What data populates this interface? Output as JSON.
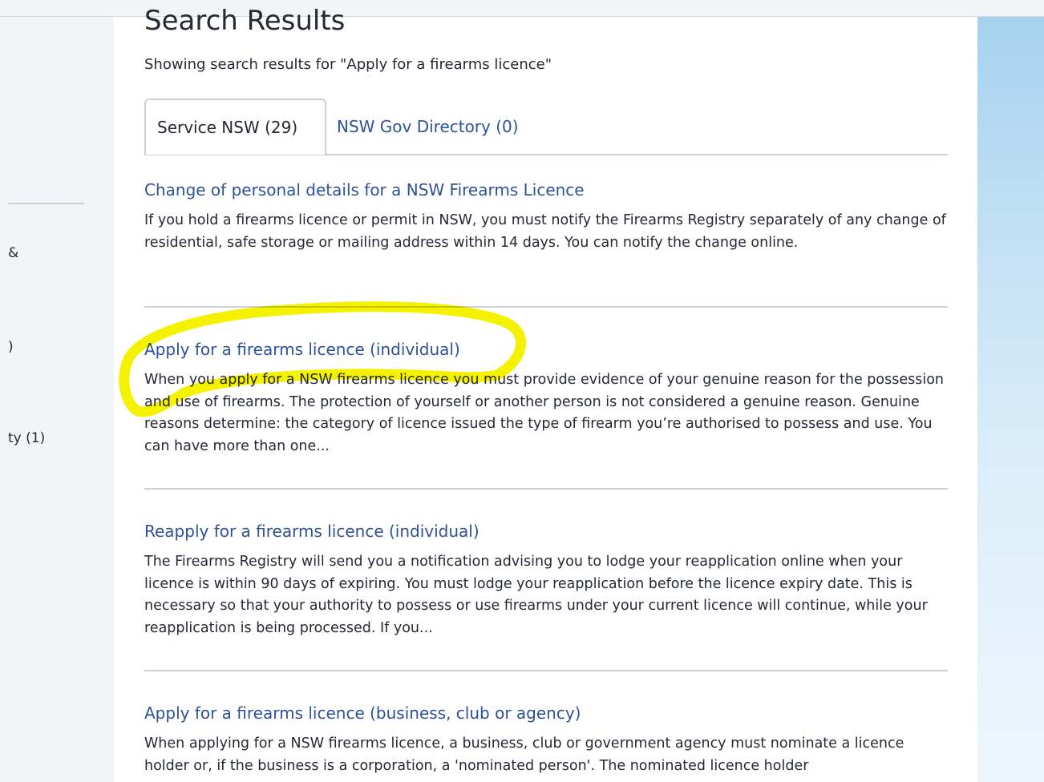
{
  "page": {
    "title": "Search Results",
    "subtitle": "Showing search results for \"Apply for a firearms licence\""
  },
  "tabs": [
    {
      "label": "Service NSW (29)"
    },
    {
      "label": "NSW Gov Directory (0)"
    }
  ],
  "sidebar": {
    "fragments": [
      "&",
      ")",
      "ty (1)"
    ]
  },
  "results": [
    {
      "title": "Change of personal details for a NSW Firearms Licence",
      "description": "If you hold a firearms licence or permit in NSW, you must notify the Firearms Registry separately of any change of residential, safe storage or mailing address within 14 days. You can notify the change online."
    },
    {
      "title": "Apply for a firearms licence (individual)",
      "description": "When you apply for a NSW firearms licence you must provide evidence of your genuine reason for the possession and use of firearms. The protection of yourself or another person is not considered a genuine reason. Genuine reasons determine: the category of licence issued the type of firearm you’re authorised to possess and use. You can have more than one..."
    },
    {
      "title": "Reapply for a firearms licence (individual)",
      "description": "The Firearms Registry will send you a notification advising you to lodge your reapplication online when your licence is within 90 days of expiring. You must lodge your reapplication before the licence expiry date. This is necessary so that your authority to possess or use firearms under your current licence will continue, while your reapplication is being processed. If you..."
    },
    {
      "title": "Apply for a firearms licence (business, club or agency)",
      "description": "When applying for a NSW firearms licence, a business, club or government agency must nominate a licence holder or, if the business is a corporation, a 'nominated person'. The nominated licence holder"
    }
  ],
  "colors": {
    "link": "#2e5299",
    "text": "#242934",
    "divider": "#c9d1db",
    "highlight": "#f5f200"
  }
}
